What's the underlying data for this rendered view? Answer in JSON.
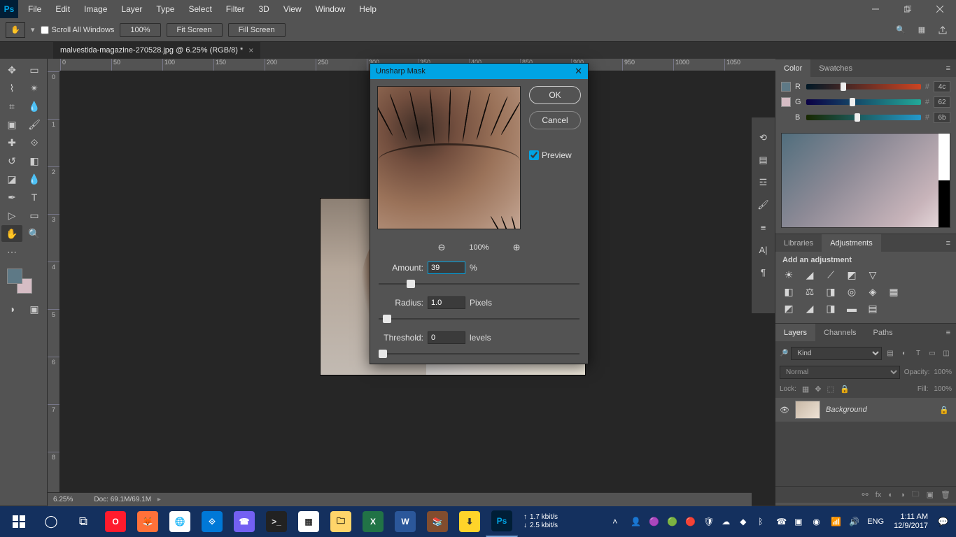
{
  "menu": {
    "items": [
      "File",
      "Edit",
      "Image",
      "Layer",
      "Type",
      "Select",
      "Filter",
      "3D",
      "View",
      "Window",
      "Help"
    ]
  },
  "optbar": {
    "scroll_all": "Scroll All Windows",
    "zoom_pct": "100%",
    "fit": "Fit Screen",
    "fill": "Fill Screen"
  },
  "doc_tab": {
    "title": "malvestida-magazine-270528.jpg @ 6.25% (RGB/8) *"
  },
  "ruler_h": [
    "0",
    "50",
    "100",
    "150",
    "200",
    "250",
    "300",
    "350",
    "400",
    "850",
    "900",
    "950",
    "1000",
    "1050"
  ],
  "ruler_v": [
    "0",
    "1",
    "2",
    "3",
    "4",
    "5",
    "6",
    "7",
    "8"
  ],
  "dialog": {
    "title": "Unsharp Mask",
    "ok": "OK",
    "cancel": "Cancel",
    "preview": "Preview",
    "zoom_lvl": "100%",
    "amount_label": "Amount:",
    "amount_value": "39",
    "amount_unit": "%",
    "radius_label": "Radius:",
    "radius_value": "1.0",
    "radius_unit": "Pixels",
    "threshold_label": "Threshold:",
    "threshold_value": "0",
    "threshold_unit": "levels"
  },
  "color_panel": {
    "tabs": [
      "Color",
      "Swatches"
    ],
    "channels": [
      {
        "label": "R",
        "value": "4c"
      },
      {
        "label": "G",
        "value": "62"
      },
      {
        "label": "B",
        "value": "6b"
      }
    ]
  },
  "adj_panel": {
    "tabs": [
      "Libraries",
      "Adjustments"
    ],
    "header": "Add an adjustment"
  },
  "layers_panel": {
    "tabs": [
      "Layers",
      "Channels",
      "Paths"
    ],
    "kind": "Kind",
    "blend": "Normal",
    "opacity_label": "Opacity:",
    "opacity_value": "100%",
    "lock_label": "Lock:",
    "fill_label": "Fill:",
    "fill_value": "100%",
    "layers": [
      {
        "name": "Background"
      }
    ]
  },
  "status": {
    "zoom": "6.25%",
    "doc_info": "Doc: 69.1M/69.1M"
  },
  "taskbar": {
    "net_up": "1.7 kbit/s",
    "net_dn": "2.5 kbit/s",
    "lang": "ENG",
    "time": "1:11 AM",
    "date": "12/9/2017"
  }
}
